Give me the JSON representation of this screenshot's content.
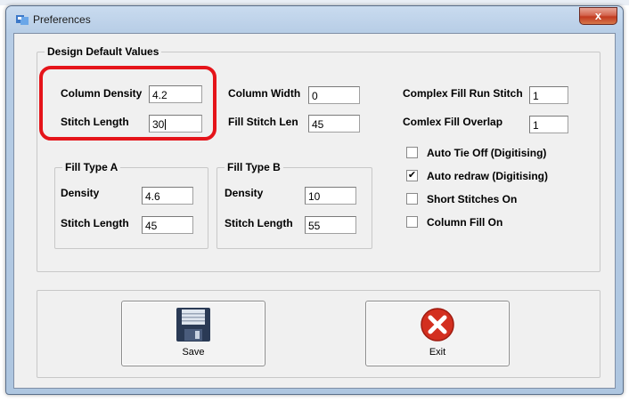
{
  "window": {
    "title": "Preferences",
    "close_symbol": "x"
  },
  "design_defaults": {
    "group_label": "Design Default Values",
    "column_density": {
      "label": "Column Density",
      "value": "4.2"
    },
    "stitch_length": {
      "label": "Stitch Length",
      "value": "30"
    },
    "column_width": {
      "label": "Column Width",
      "value": "0"
    },
    "fill_stitch_len": {
      "label": "Fill Stitch Len",
      "value": "45"
    },
    "complex_fill_run_stitch": {
      "label": "Complex Fill Run Stitch",
      "value": "1"
    },
    "complex_fill_overlap": {
      "label": "Comlex Fill Overlap",
      "value": "1"
    }
  },
  "fill_type_a": {
    "group_label": "Fill Type A",
    "density": {
      "label": "Density",
      "value": "4.6"
    },
    "stitch_length": {
      "label": "Stitch Length",
      "value": "45"
    }
  },
  "fill_type_b": {
    "group_label": "Fill Type B",
    "density": {
      "label": "Density",
      "value": "10"
    },
    "stitch_length": {
      "label": "Stitch Length",
      "value": "55"
    }
  },
  "options": [
    {
      "label": "Auto Tie Off (Digitising)",
      "checked": false
    },
    {
      "label": "Auto redraw (Digitising)",
      "checked": true
    },
    {
      "label": "Short Stitches On",
      "checked": false
    },
    {
      "label": "Column Fill On",
      "checked": false
    }
  ],
  "check_mark": "✔",
  "buttons": {
    "save_label": "Save",
    "exit_label": "Exit"
  },
  "colors": {
    "highlight": "#e5141a",
    "exit_icon": "#d32f1f",
    "save_icon": "#2a3a55"
  }
}
